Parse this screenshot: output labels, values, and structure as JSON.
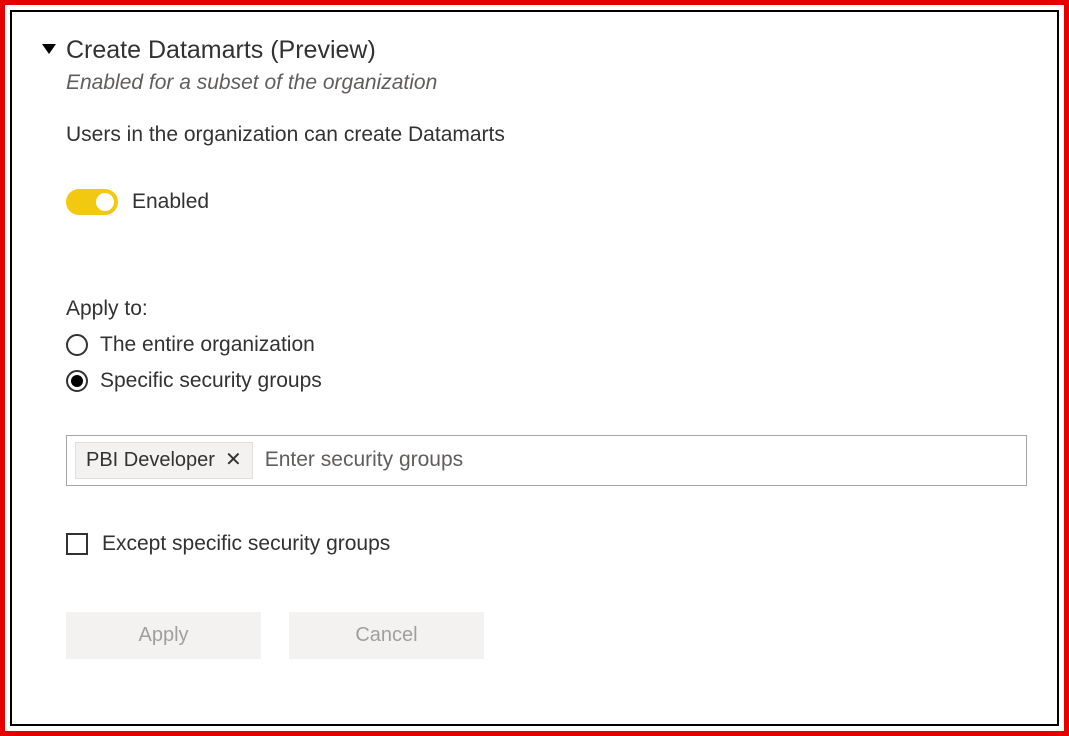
{
  "header": {
    "title": "Create Datamarts (Preview)",
    "subtitle": "Enabled for a subset of the organization"
  },
  "description": "Users in the organization can create Datamarts",
  "toggle": {
    "label": "Enabled",
    "enabled": true
  },
  "applyTo": {
    "label": "Apply to:",
    "options": {
      "entire": "The entire organization",
      "specific": "Specific security groups"
    },
    "selected": "specific"
  },
  "securityGroupsInput": {
    "placeholder": "Enter security groups",
    "tags": {
      "pbi": "PBI Developer"
    }
  },
  "exceptCheckbox": {
    "label": "Except specific security groups",
    "checked": false
  },
  "buttons": {
    "apply": "Apply",
    "cancel": "Cancel"
  }
}
